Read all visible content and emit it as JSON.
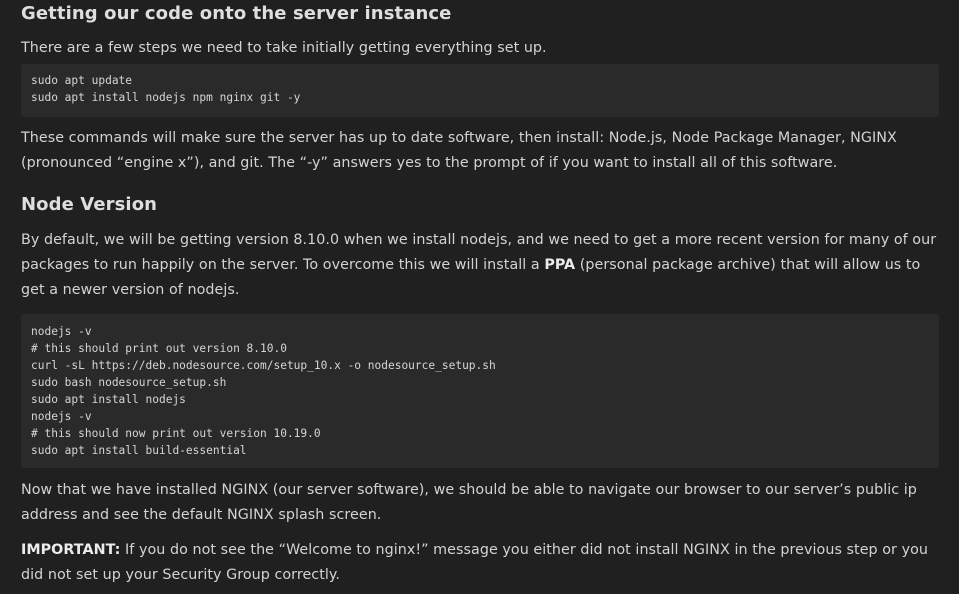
{
  "sections": [
    {
      "heading": "Getting our code onto the server instance",
      "intro": "There are a few steps we need to take initially getting everything set up.",
      "code": [
        "sudo apt update",
        "sudo apt install nodejs npm nginx git -y"
      ],
      "explanation": "These commands will make sure the server has up to date software, then install: Node.js, Node Package Manager, NGINX (pronounced “engine x”), and git. The “-y” answers yes to the prompt of if you want to install all of this software."
    },
    {
      "heading": "Node Version",
      "intro_before": "By default, we will be getting version 8.10.0 when we install nodejs, and we need to get a more recent version for many of our packages to run happily on the server. To overcome this we will install a ",
      "intro_bold": "PPA",
      "intro_after": " (personal package archive) that will allow us to get a newer version of nodejs.",
      "code": [
        "nodejs -v",
        "# this should print out version 8.10.0",
        "curl -sL https://deb.nodesource.com/setup_10.x -o nodesource_setup.sh",
        "sudo bash nodesource_setup.sh",
        "sudo apt install nodejs",
        "nodejs -v",
        "# this should now print out version 10.19.0",
        "sudo apt install build-essential"
      ],
      "after": "Now that we have installed NGINX (our server software), we should be able to navigate our browser to our server’s public ip address and see the default NGINX splash screen.",
      "important_label": "IMPORTANT:",
      "important_text": " If you do not see the “Welcome to nginx!” message you either did not install NGINX in the previous step or you did not set up your Security Group correctly."
    }
  ]
}
